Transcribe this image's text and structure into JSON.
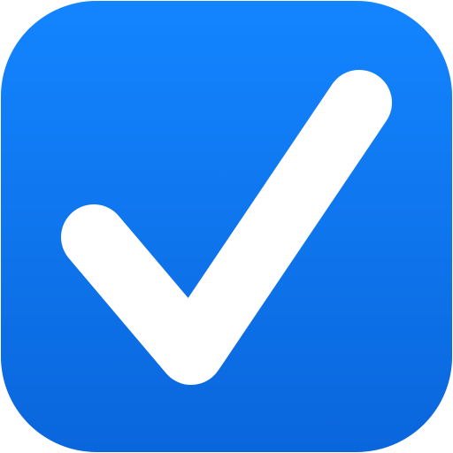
{
  "icon": {
    "name": "checkmark-app-icon",
    "colors": {
      "background_top": "#1385FF",
      "background_bottom": "#0A66DC",
      "glyph": "#FFFFFF"
    },
    "glyph_icon": "checkmark-icon"
  }
}
